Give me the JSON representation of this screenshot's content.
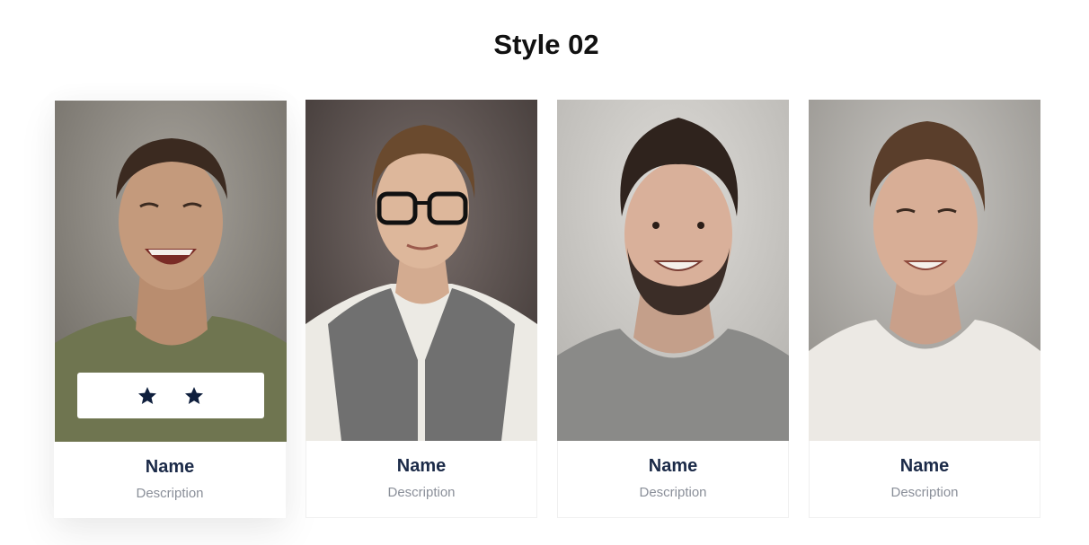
{
  "section": {
    "title": "Style 02"
  },
  "cards": [
    {
      "name": "Name",
      "description": "Description",
      "photo": "laughing-man-portrait",
      "social_icons": [
        "star-icon",
        "star-icon"
      ]
    },
    {
      "name": "Name",
      "description": "Description",
      "photo": "man-with-glasses-portrait"
    },
    {
      "name": "Name",
      "description": "Description",
      "photo": "bearded-man-portrait"
    },
    {
      "name": "Name",
      "description": "Description",
      "photo": "smiling-man-portrait"
    }
  ],
  "colors": {
    "name_text": "#1b2a48",
    "description_text": "#8a8f99",
    "icon": "#0f1f3d",
    "background": "#ffffff"
  }
}
